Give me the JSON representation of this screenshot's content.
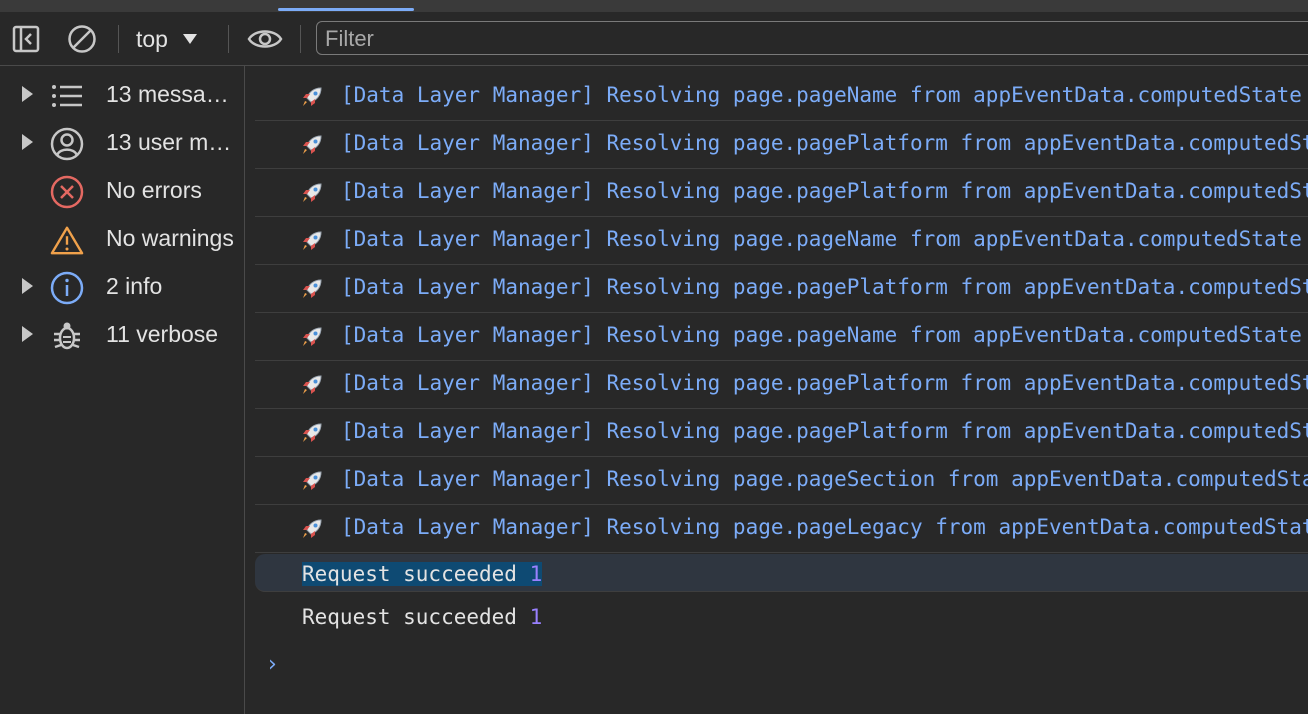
{
  "toolbar": {
    "context_label": "top",
    "filter_placeholder": "Filter"
  },
  "sidebar": {
    "items": [
      {
        "label": "13 messa…",
        "icon": "list-icon"
      },
      {
        "label": "13 user m…",
        "icon": "user-icon"
      },
      {
        "label": "No errors",
        "icon": "error-icon"
      },
      {
        "label": "No warnings",
        "icon": "warning-icon"
      },
      {
        "label": "2 info",
        "icon": "info-icon"
      },
      {
        "label": "11 verbose",
        "icon": "bug-icon"
      }
    ]
  },
  "console": {
    "logs": [
      {
        "text": "[Data Layer Manager] Resolving page.pageName from appEventData.computedState"
      },
      {
        "text": "[Data Layer Manager] Resolving page.pagePlatform from appEventData.computedState"
      },
      {
        "text": "[Data Layer Manager] Resolving page.pagePlatform from appEventData.computedState"
      },
      {
        "text": "[Data Layer Manager] Resolving page.pageName from appEventData.computedState"
      },
      {
        "text": "[Data Layer Manager] Resolving page.pagePlatform from appEventData.computedState"
      },
      {
        "text": "[Data Layer Manager] Resolving page.pageName from appEventData.computedState"
      },
      {
        "text": "[Data Layer Manager] Resolving page.pagePlatform from appEventData.computedState"
      },
      {
        "text": "[Data Layer Manager] Resolving page.pagePlatform from appEventData.computedState"
      },
      {
        "text": "[Data Layer Manager] Resolving page.pageSection from appEventData.computedState"
      },
      {
        "text": "[Data Layer Manager] Resolving page.pageLegacy from appEventData.computedState"
      }
    ],
    "results": [
      {
        "text": "Request succeeded",
        "count": "1"
      },
      {
        "text": "Request succeeded",
        "count": "1"
      }
    ]
  },
  "colors": {
    "accent": "#7cacf8",
    "error": "#e46962",
    "warning": "#f0a14b",
    "info": "#7cacf8"
  }
}
